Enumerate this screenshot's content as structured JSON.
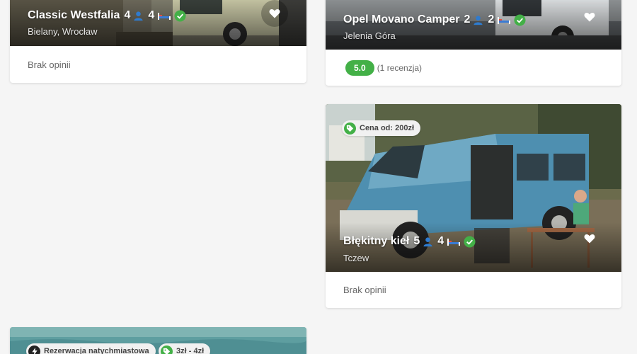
{
  "listings": [
    {
      "title": "Classic Westfalia",
      "seats": "4",
      "beds": "4",
      "location": "Bielany, Wrocław",
      "reviews_text": "Brak opinii"
    },
    {
      "title": "Opel Movano Camper",
      "seats": "2",
      "beds": "2",
      "location": "Jelenia Góra",
      "rating": "5.0",
      "reviews_text": "(1 recenzja)"
    },
    {
      "title": "Błękitny kieł",
      "seats": "5",
      "beds": "4",
      "location": "Tczew",
      "price_tag": "Cena od: 200zł",
      "reviews_text": "Brak opinii"
    },
    {
      "instant_booking": "Rezerwacja natychmiastowa",
      "price_tag": "3zł - 4zł"
    }
  ],
  "icons": {
    "seats": "person-icon",
    "beds": "bed-icon",
    "verified": "check-circle-icon",
    "favorite": "heart-icon",
    "price": "price-tag-icon",
    "instant": "lightning-icon"
  },
  "colors": {
    "page_bg": "#f5f5f5",
    "accent_green": "#43b047",
    "person_blue": "#2e7bcf"
  }
}
